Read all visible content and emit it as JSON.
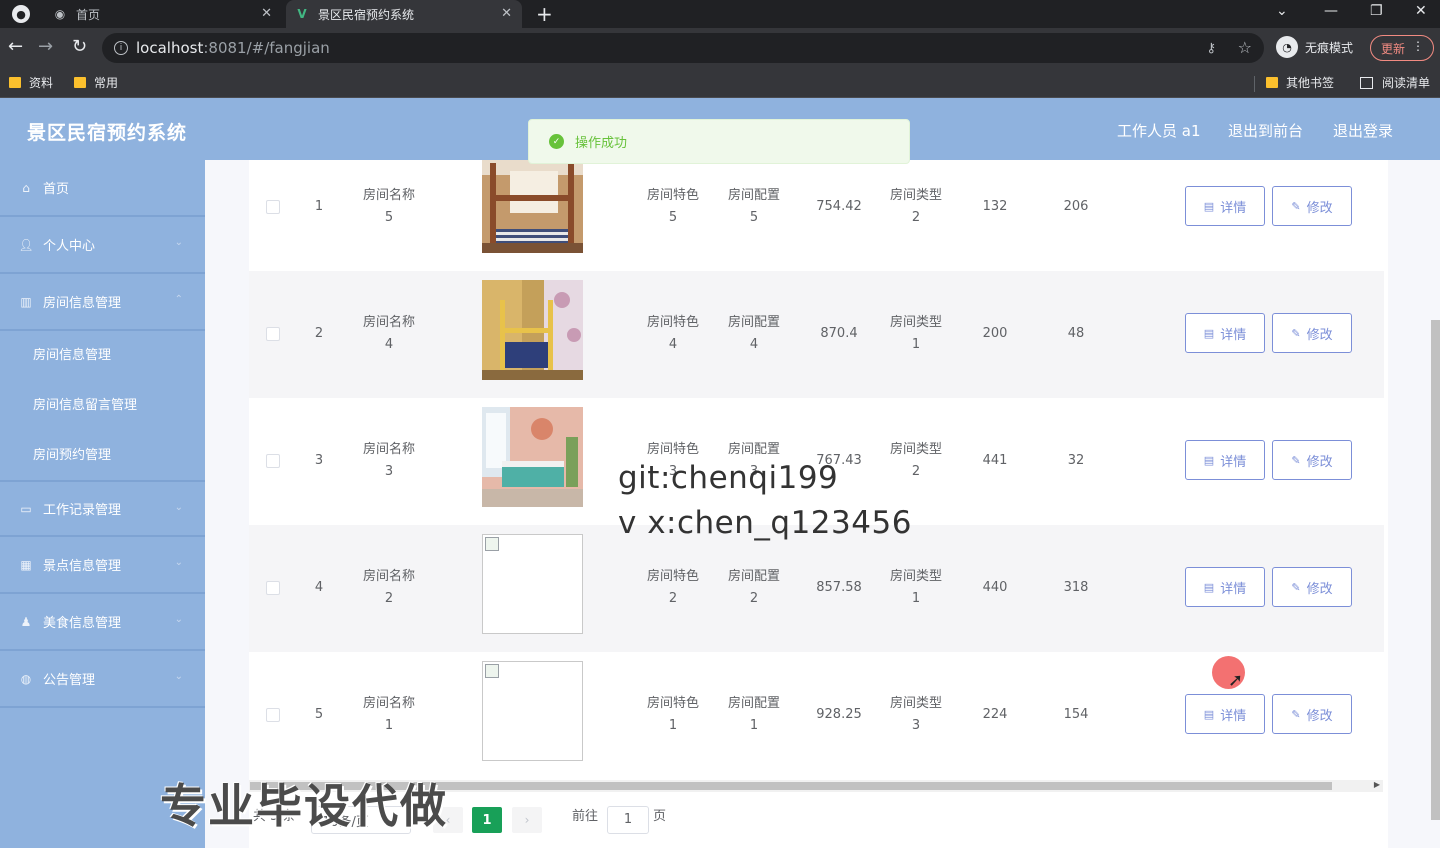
{
  "browser": {
    "tabs": [
      {
        "title": "首页",
        "active": false
      },
      {
        "title": "景区民宿预约系统",
        "active": true
      }
    ],
    "url_host": "localhost",
    "url_path": ":8081/#/fangjian",
    "incognito_label": "无痕模式",
    "update_label": "更新",
    "bookmarks": [
      "资料",
      "常用"
    ],
    "other_bookmarks": "其他书签",
    "reading_list": "阅读清单"
  },
  "header": {
    "title": "景区民宿预约系统",
    "user": "工作人员 a1",
    "to_front": "退出到前台",
    "logout": "退出登录"
  },
  "toast": {
    "message": "操作成功"
  },
  "sidebar": {
    "items": [
      {
        "label": "首页",
        "icon": "home-icon"
      },
      {
        "label": "个人中心",
        "icon": "user-icon"
      },
      {
        "label": "房间信息管理",
        "icon": "building-icon"
      },
      {
        "label": "工作记录管理",
        "icon": "notebook-icon"
      },
      {
        "label": "景点信息管理",
        "icon": "grid-icon"
      },
      {
        "label": "美食信息管理",
        "icon": "person-icon"
      },
      {
        "label": "公告管理",
        "icon": "globe-icon"
      }
    ],
    "submenu": [
      "房间信息管理",
      "房间信息留言管理",
      "房间预约管理"
    ]
  },
  "table": {
    "rows": [
      {
        "index": "1",
        "name_label": "房间名称",
        "name": "5",
        "image": "photo",
        "feature_label": "房间特色",
        "feature": "5",
        "config_label": "房间配置",
        "config": "5",
        "price": "754.42",
        "type_label": "房间类型",
        "type": "2",
        "c1": "132",
        "c2": "206"
      },
      {
        "index": "2",
        "name_label": "房间名称",
        "name": "4",
        "image": "photo",
        "feature_label": "房间特色",
        "feature": "4",
        "config_label": "房间配置",
        "config": "4",
        "price": "870.4",
        "type_label": "房间类型",
        "type": "1",
        "c1": "200",
        "c2": "48"
      },
      {
        "index": "3",
        "name_label": "房间名称",
        "name": "3",
        "image": "photo",
        "feature_label": "房间特色",
        "feature": "3",
        "config_label": "房间配置",
        "config": "3",
        "price": "767.43",
        "type_label": "房间类型",
        "type": "2",
        "c1": "441",
        "c2": "32"
      },
      {
        "index": "4",
        "name_label": "房间名称",
        "name": "2",
        "image": "broken",
        "feature_label": "房间特色",
        "feature": "2",
        "config_label": "房间配置",
        "config": "2",
        "price": "857.58",
        "type_label": "房间类型",
        "type": "1",
        "c1": "440",
        "c2": "318"
      },
      {
        "index": "5",
        "name_label": "房间名称",
        "name": "1",
        "image": "broken",
        "feature_label": "房间特色",
        "feature": "1",
        "config_label": "房间配置",
        "config": "1",
        "price": "928.25",
        "type_label": "房间类型",
        "type": "3",
        "c1": "224",
        "c2": "154"
      }
    ],
    "detail_label": "详情",
    "edit_label": "修改"
  },
  "pagination": {
    "total": "共 5 条",
    "page_size": "10条/页",
    "current": "1",
    "goto_label": "前往",
    "goto_value": "1",
    "page_suffix": "页"
  },
  "overlay": {
    "watermark_line1": "git:chenqi199",
    "watermark_line2": "v x:chen_q123456",
    "promo": "专业毕设代做"
  },
  "colors": {
    "header_bg": "#8fb2de",
    "accent": "#7c8fd8",
    "success": "#67c23a",
    "page_active": "#18a058"
  }
}
